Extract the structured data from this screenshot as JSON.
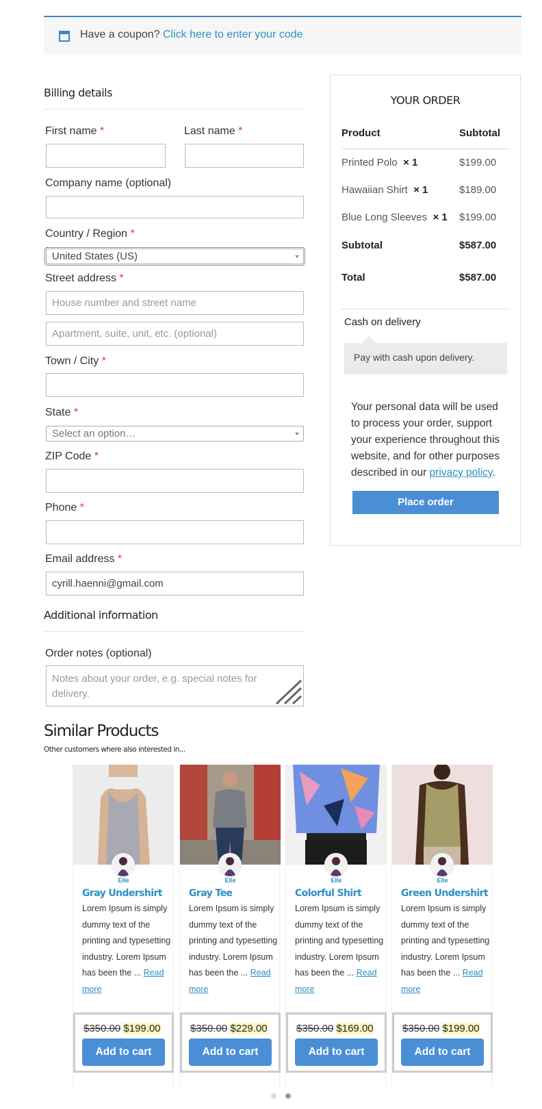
{
  "coupon": {
    "text": "Have a coupon?",
    "link": "Click here to enter your code"
  },
  "billing": {
    "title": "Billing details",
    "first_name": "First name",
    "last_name": "Last name",
    "company": "Company name (optional)",
    "country": "Country / Region",
    "country_value": "United States (US)",
    "street": "Street address",
    "street_ph1": "House number and street name",
    "street_ph2": "Apartment, suite, unit, etc. (optional)",
    "city": "Town / City",
    "state": "State",
    "state_value": "Select an option…",
    "zip": "ZIP Code",
    "phone": "Phone",
    "email": "Email address",
    "email_value": "cyrill.haenni@gmail.com",
    "required_mark": "*"
  },
  "additional": {
    "title": "Additional information",
    "notes_label": "Order notes (optional)",
    "notes_ph": "Notes about your order, e.g. special notes for delivery."
  },
  "order": {
    "title": "YOUR ORDER",
    "col_product": "Product",
    "col_subtotal": "Subtotal",
    "items": [
      {
        "name": "Printed Polo",
        "qty": "× 1",
        "price": "$199.00"
      },
      {
        "name": "Hawaiian Shirt",
        "qty": "× 1",
        "price": "$189.00"
      },
      {
        "name": "Blue Long Sleeves",
        "qty": "× 1",
        "price": "$199.00"
      }
    ],
    "subtotal_label": "Subtotal",
    "subtotal": "$587.00",
    "total_label": "Total",
    "total": "$587.00",
    "payment_method": "Cash on delivery",
    "payment_desc": "Pay with cash upon delivery.",
    "privacy_text": "Your personal data will be used to process your order, support your experience throughout this website, and for other purposes described in our",
    "privacy_link": "privacy policy",
    "privacy_end": ".",
    "place_order": "Place order"
  },
  "similar": {
    "title": "Similar Products",
    "subtitle": "Other customers where also interested in...",
    "products": [
      {
        "author": "Elle",
        "name": "Gray Undershirt",
        "desc": "Lorem Ipsum is simply dummy text of the printing and typesetting industry. Lorem Ipsum has been the ...",
        "read_more": "Read more",
        "old_price": "$350.00",
        "new_price": "$199.00",
        "cta": "Add to cart"
      },
      {
        "author": "Elle",
        "name": "Gray Tee",
        "desc": "Lorem Ipsum is simply dummy text of the printing and typesetting industry. Lorem Ipsum has been the ...",
        "read_more": "Read more",
        "old_price": "$350.00",
        "new_price": "$229.00",
        "cta": "Add to cart"
      },
      {
        "author": "Elle",
        "name": "Colorful Shirt",
        "desc": "Lorem Ipsum is simply dummy text of the printing and typesetting industry. Lorem Ipsum has been the ...",
        "read_more": "Read more",
        "old_price": "$350.00",
        "new_price": "$169.00",
        "cta": "Add to cart"
      },
      {
        "author": "Elle",
        "name": "Green Undershirt",
        "desc": "Lorem Ipsum is simply dummy text of the printing and typesetting industry. Lorem Ipsum has been the ...",
        "read_more": "Read more",
        "old_price": "$350.00",
        "new_price": "$199.00",
        "cta": "Add to cart"
      }
    ]
  },
  "colors": {
    "accent": "#4a8fd6",
    "link": "#2b8fc6",
    "required": "#e2401c",
    "sale_highlight": "#fdf7c0"
  },
  "carousel": {
    "pages": 2,
    "active": 2
  }
}
